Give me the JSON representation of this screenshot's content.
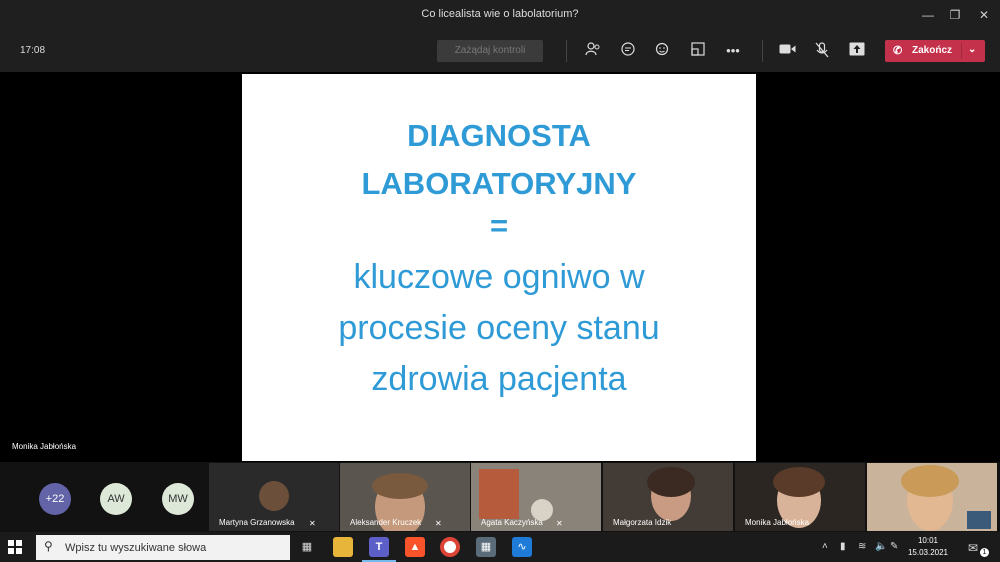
{
  "window": {
    "title": "Co licealista wie o labolatorium?",
    "minimize_icon": "minimize-icon",
    "restore_icon": "restore-icon",
    "close_icon": "close-icon"
  },
  "toolbar": {
    "time": "17:08",
    "request_control_label": "Zażądaj kontroli",
    "end_call_label": "Zakończ",
    "icons": [
      "people-icon",
      "chat-icon",
      "reactions-icon",
      "room-icon",
      "more-icon",
      "camera-icon",
      "mic-off-icon",
      "share-icon"
    ]
  },
  "slide": {
    "heading_lines": [
      "DIAGNOSTA",
      "LABORATORYJNY"
    ],
    "equals": "=",
    "body_lines": [
      "kluczowe ogniwo w",
      "procesie oceny stanu",
      "zdrowia pacjenta"
    ],
    "text_color": "#2e9ad6"
  },
  "presenter_name": "Monika Jabłońska",
  "participants": {
    "overflow_count": "+22",
    "initials": [
      "AW",
      "MW"
    ],
    "tiles": [
      {
        "name": "Martyna Grzanowska"
      },
      {
        "name": "Aleksander Kruczek"
      },
      {
        "name": "Agata Kaczyńska"
      },
      {
        "name": "Małgorzata Idzik"
      },
      {
        "name": "Monika Jabłońska"
      },
      {
        "name": ""
      }
    ]
  },
  "taskbar": {
    "search_placeholder": "Wpisz tu wyszukiwane słowa",
    "time": "10:01",
    "date": "15.03.2021",
    "notification_count": "1"
  }
}
